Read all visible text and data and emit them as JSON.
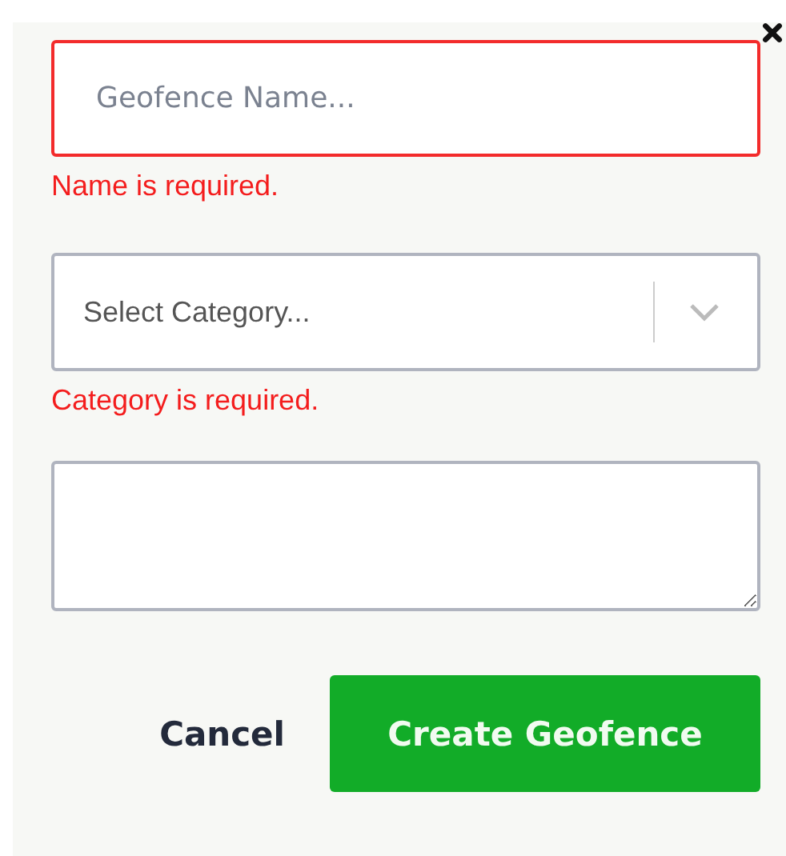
{
  "name_field": {
    "placeholder": "Geofence Name...",
    "invalid": true,
    "error": "Name is required."
  },
  "category_select": {
    "placeholder": "Select Category...",
    "invalid": false,
    "error": "Category is required."
  },
  "buttons": [
    {
      "label": "Cancel",
      "kind": "secondary"
    },
    {
      "label": "Create Geofence",
      "kind": "primary"
    }
  ]
}
